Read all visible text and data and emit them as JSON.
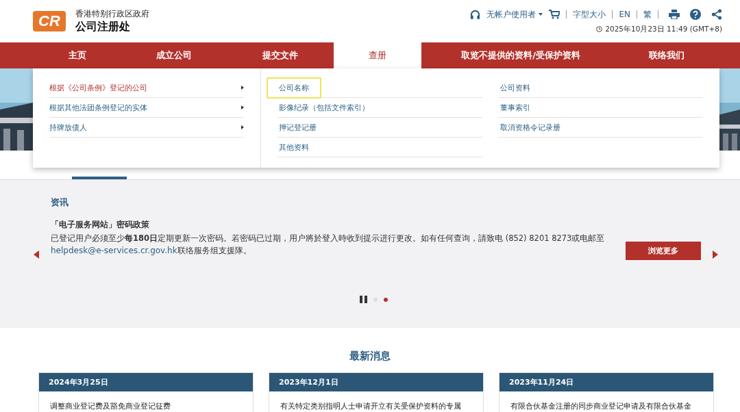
{
  "header": {
    "logo_text": "CR",
    "org_line1": "香港特别行政区政府",
    "org_line2": "公司注册处",
    "user_menu": "无帐户使用者",
    "links": [
      "字型大小",
      "EN",
      "繁"
    ],
    "datetime": "2025年10月23日 11:49 (GMT+8)"
  },
  "nav": [
    {
      "label": "主页",
      "selected": false
    },
    {
      "label": "成立公司",
      "selected": false
    },
    {
      "label": "提交文件",
      "selected": false
    },
    {
      "label": "查册",
      "selected": true
    },
    {
      "label": "取览不提供的资料/受保护资料",
      "selected": false
    },
    {
      "label": "联络我们",
      "selected": false
    }
  ],
  "mega_menu": {
    "categories": [
      {
        "label": "根据《公司条例》登记的公司",
        "selected": true
      },
      {
        "label": "根据其他法团条例登记的实体",
        "selected": false
      },
      {
        "label": "持牌放债人",
        "selected": false
      }
    ],
    "column_1": [
      {
        "label": "公司名称",
        "focused": true
      },
      {
        "label": "影像纪录（包括文件索引）",
        "focused": false
      },
      {
        "label": "押记登记册",
        "focused": false
      },
      {
        "label": "其他资料",
        "focused": false
      }
    ],
    "column_2": [
      {
        "label": "公司资料",
        "focused": false
      },
      {
        "label": "董事索引",
        "focused": false
      },
      {
        "label": "取消资格令记录册",
        "focused": false
      }
    ]
  },
  "info": {
    "heading": "资讯",
    "title": "「电子服务网站」密码政策",
    "body": "已登记用户必须至少**每180日**定期更新一次密码。若密码已过期，用户將於登入時收到提示进行更改。如有任何查询，請致电 (852) 8201 8273或电邮至",
    "link": "helpdesk@e-services.cr.gov.hk",
    "body_end": "联络服务组支援隊。",
    "button": "浏览更多",
    "dots": [
      {
        "selected": false
      },
      {
        "selected": true
      }
    ]
  },
  "news": {
    "heading": "最新消息",
    "cards": [
      {
        "date": "2024年3月25日",
        "title": "调整商业登记费及豁免商业登记征费"
      },
      {
        "date": "2023年12月1日",
        "title": "有关特定类别指明人士申请开立有关受保护资料的专属"
      },
      {
        "date": "2023年11月24日",
        "title": "有限合伙基金注册的同步商业登记申请及有限合伙基金"
      }
    ]
  }
}
